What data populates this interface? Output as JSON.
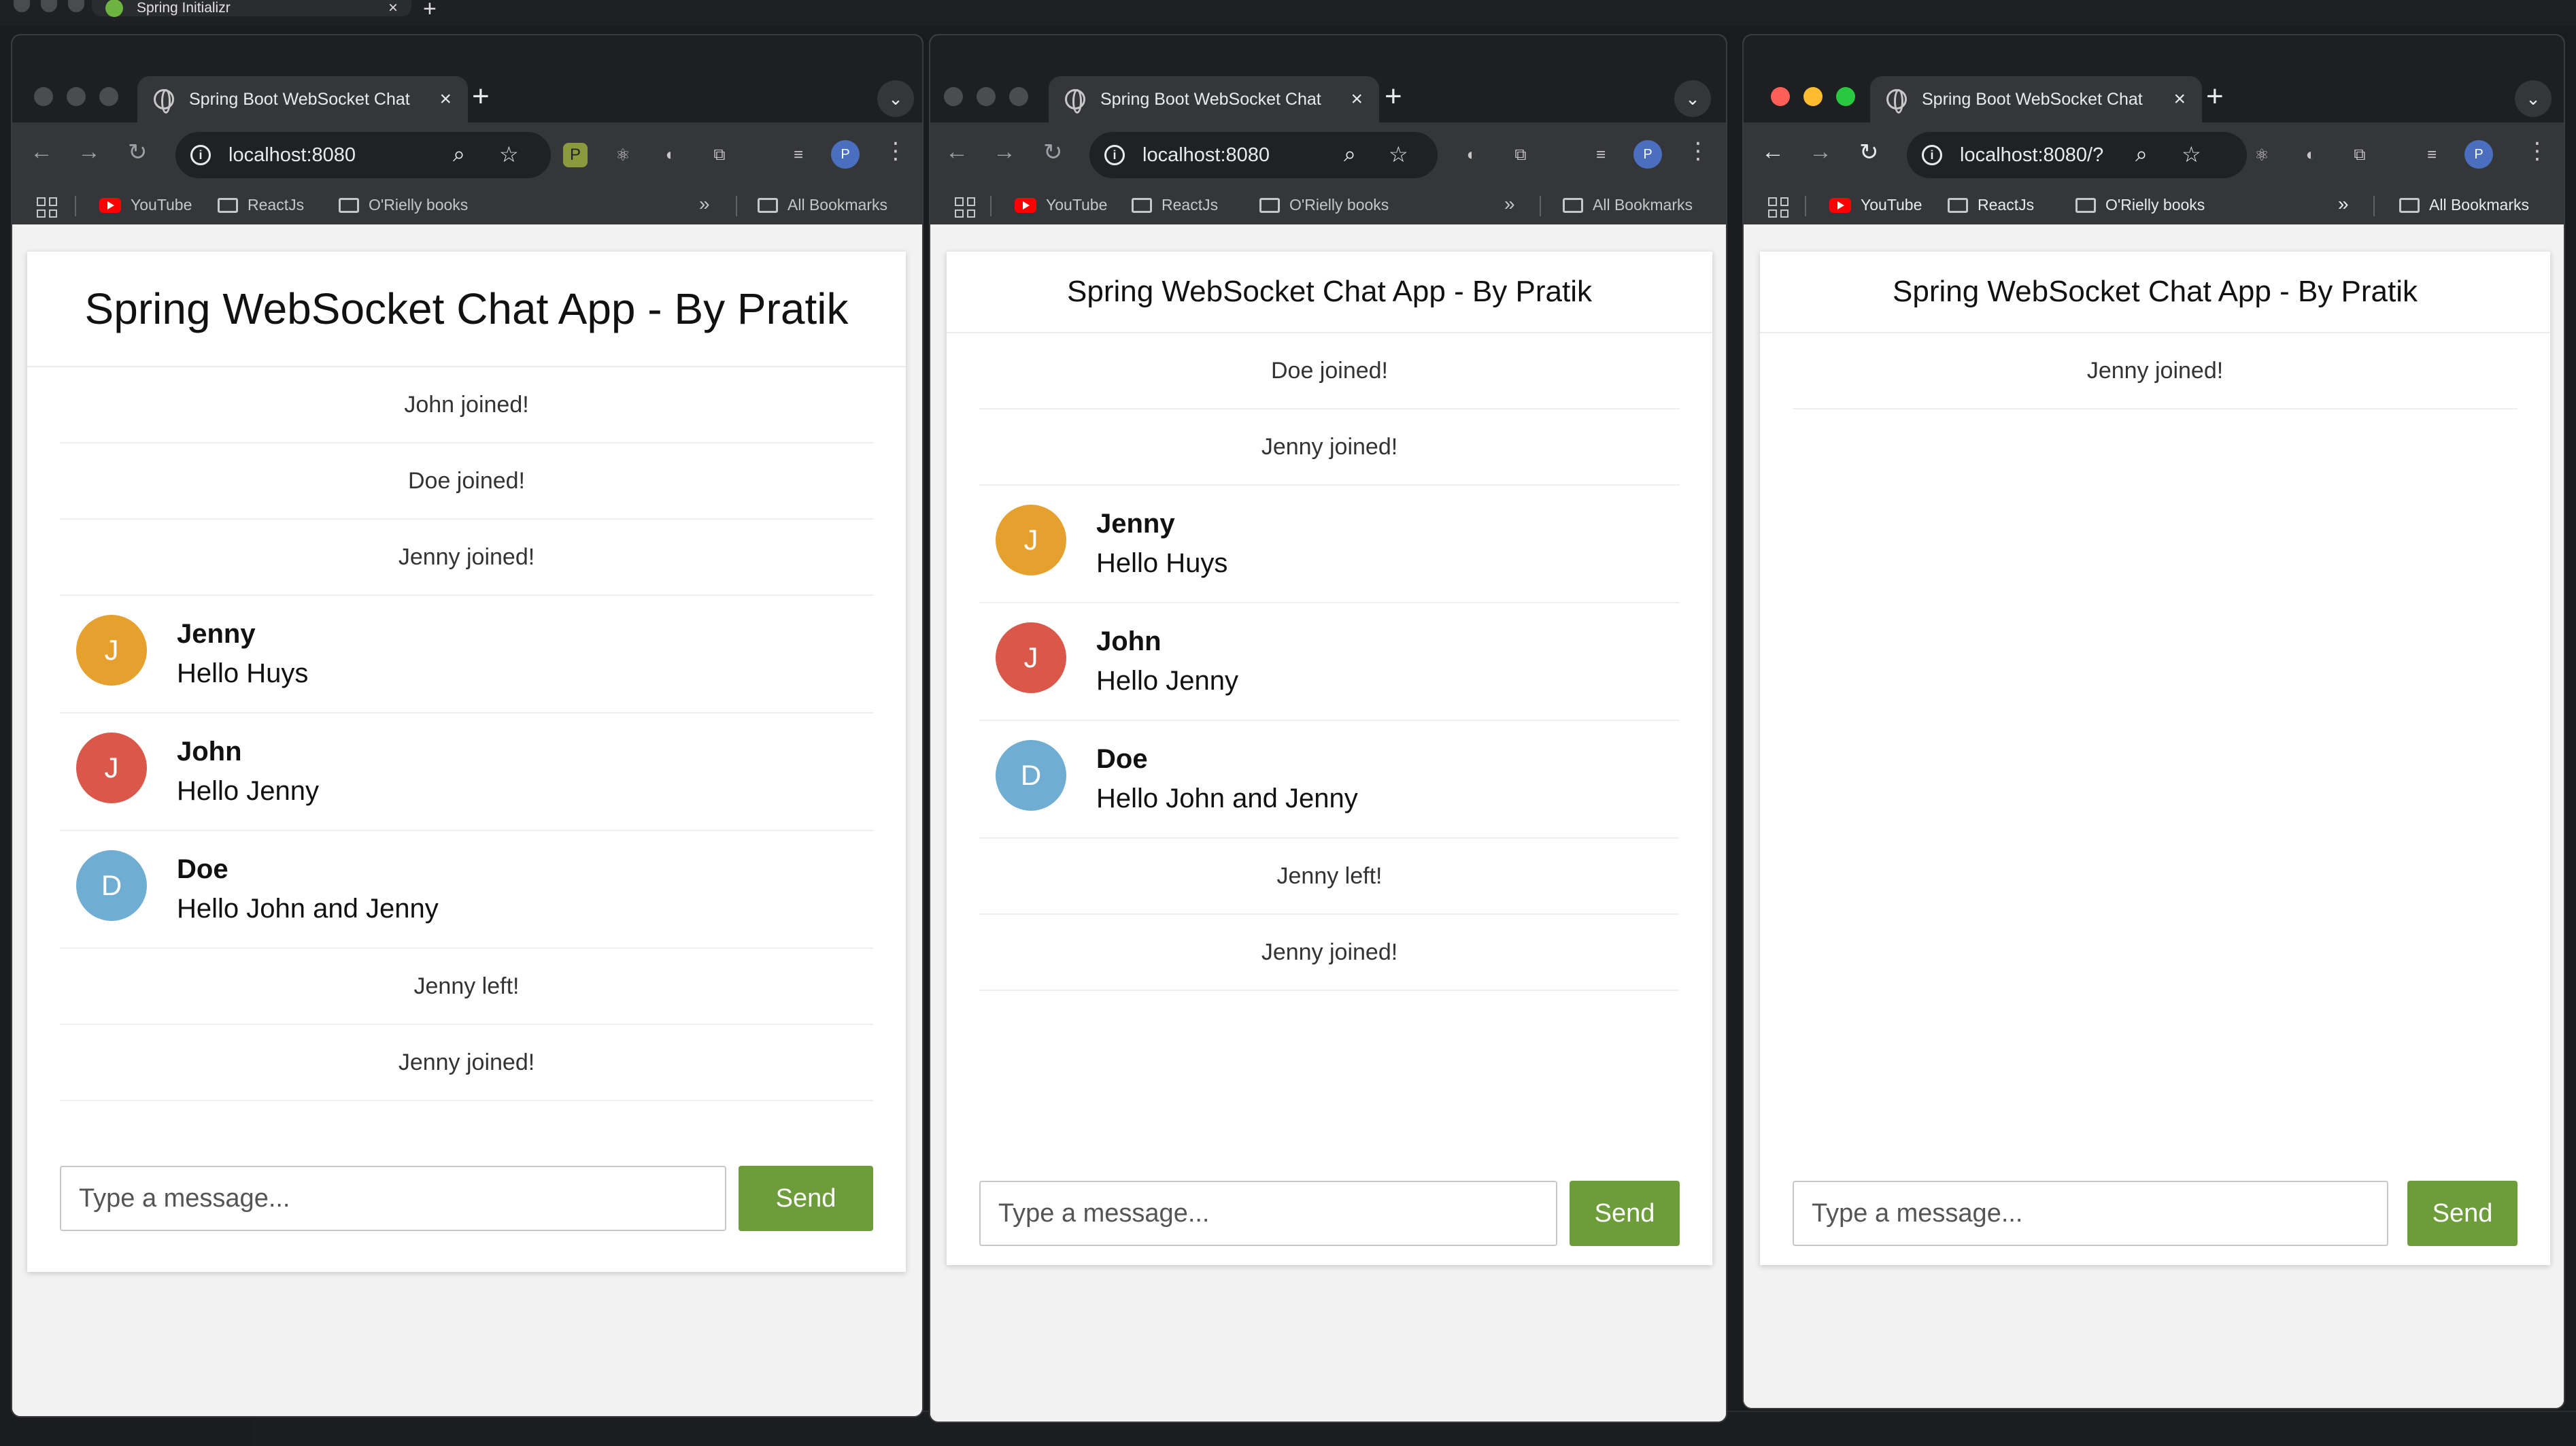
{
  "background": {
    "tab_title": "Spring Initializr"
  },
  "windows": [
    {
      "tab_title": "Spring Boot WebSocket Chat",
      "url": "localhost:8080",
      "bookmarks": {
        "youtube": "YouTube",
        "reactjs": "ReactJs",
        "oreilly": "O'Rielly books",
        "all": "All Bookmarks",
        "more": "»"
      },
      "app_title": "Spring WebSocket Chat App - By Pratik",
      "events_top": [
        "John joined!",
        "Doe joined!",
        "Jenny joined!"
      ],
      "messages": [
        {
          "initial": "J",
          "sender": "Jenny",
          "text": "Hello Huys",
          "color": "#e5a02d"
        },
        {
          "initial": "J",
          "sender": "John",
          "text": "Hello Jenny",
          "color": "#d9584a"
        },
        {
          "initial": "D",
          "sender": "Doe",
          "text": "Hello John and Jenny",
          "color": "#6fadd3"
        }
      ],
      "events_bottom": [
        "Jenny left!",
        "Jenny joined!"
      ],
      "input_placeholder": "Type a message...",
      "send_label": "Send",
      "avatar_letter": "P"
    },
    {
      "tab_title": "Spring Boot WebSocket Chat",
      "url": "localhost:8080",
      "bookmarks": {
        "youtube": "YouTube",
        "reactjs": "ReactJs",
        "oreilly": "O'Rielly books",
        "all": "All Bookmarks",
        "more": "»"
      },
      "app_title": "Spring WebSocket Chat App - By Pratik",
      "events_top": [
        "Doe joined!",
        "Jenny joined!"
      ],
      "messages": [
        {
          "initial": "J",
          "sender": "Jenny",
          "text": "Hello Huys",
          "color": "#e5a02d"
        },
        {
          "initial": "J",
          "sender": "John",
          "text": "Hello Jenny",
          "color": "#d9584a"
        },
        {
          "initial": "D",
          "sender": "Doe",
          "text": "Hello John and Jenny",
          "color": "#6fadd3"
        }
      ],
      "events_bottom": [
        "Jenny left!",
        "Jenny joined!"
      ],
      "input_placeholder": "Type a message...",
      "send_label": "Send",
      "avatar_letter": "P"
    },
    {
      "tab_title": "Spring Boot WebSocket Chat",
      "url": "localhost:8080/?",
      "bookmarks": {
        "youtube": "YouTube",
        "reactjs": "ReactJs",
        "oreilly": "O'Rielly books",
        "all": "All Bookmarks",
        "more": "»"
      },
      "app_title": "Spring WebSocket Chat App - By Pratik",
      "events_top": [
        "Jenny joined!"
      ],
      "messages": [],
      "events_bottom": [],
      "input_placeholder": "Type a message...",
      "send_label": "Send",
      "avatar_letter": "P"
    }
  ]
}
